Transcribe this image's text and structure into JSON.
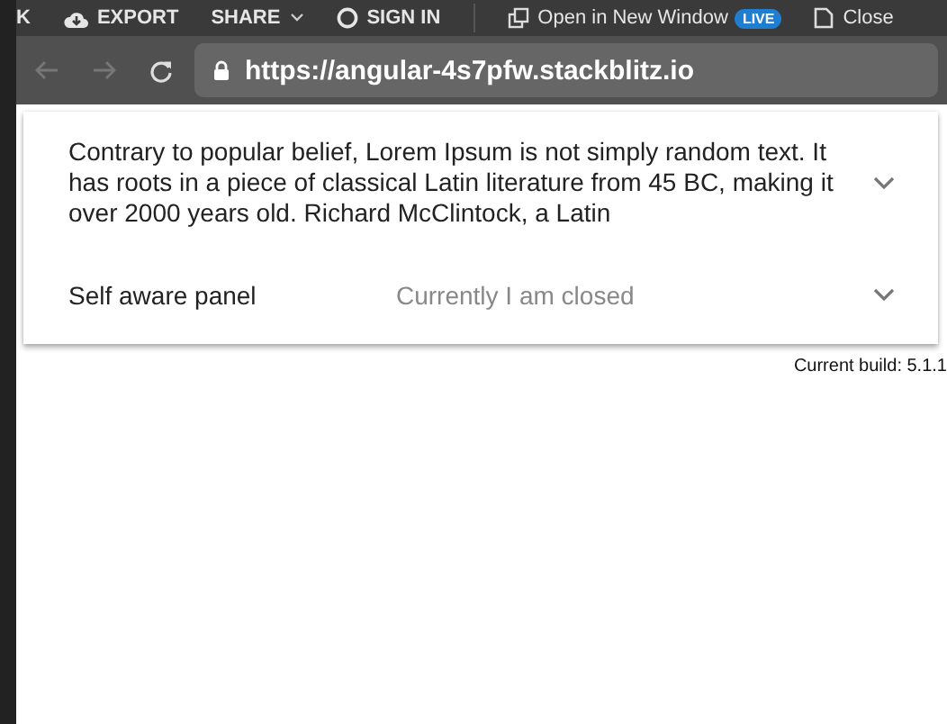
{
  "toolbar": {
    "items": [
      {
        "kind": "text",
        "label": "K"
      },
      {
        "kind": "export",
        "label": "EXPORT"
      },
      {
        "kind": "share",
        "label": "SHARE"
      },
      {
        "kind": "signin",
        "label": "SIGN IN"
      },
      {
        "kind": "open",
        "label": "Open in New Window",
        "badge": "LIVE"
      },
      {
        "kind": "close",
        "label": "Close"
      }
    ]
  },
  "browser": {
    "back_disabled": true,
    "forward_disabled": true,
    "url": "https://angular-4s7pfw.stackblitz.io"
  },
  "panels": [
    {
      "title": "Contrary to popular belief, Lorem Ipsum is not simply random text. It has roots in a piece of classical Latin literature from 45 BC, making it over 2000 years old. Richard McClintock, a Latin",
      "expanded": false
    },
    {
      "title": "Self aware panel",
      "description": "Currently I am closed",
      "expanded": false
    }
  ],
  "build_note": "Current build: 5.1.1"
}
